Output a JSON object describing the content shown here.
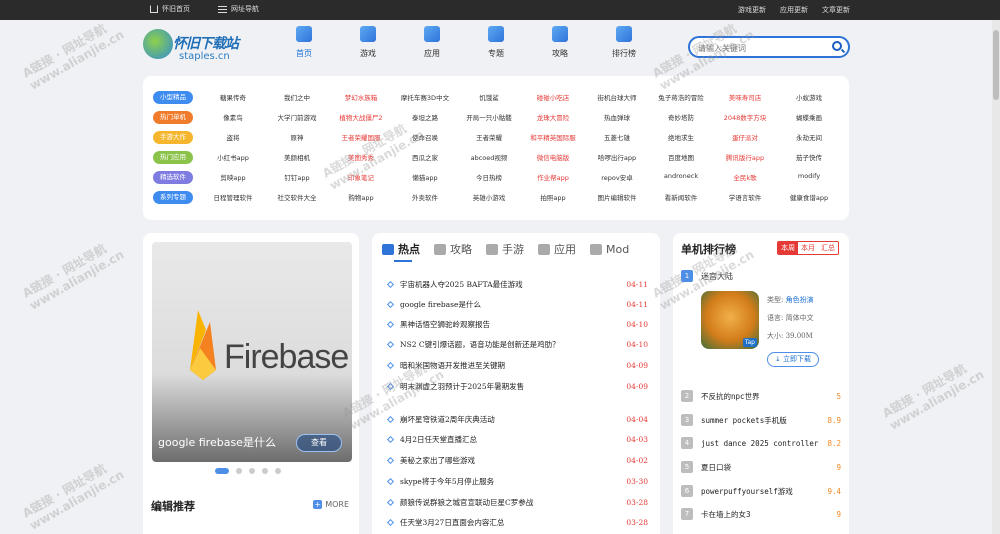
{
  "topbar": {
    "home": "怀旧首页",
    "nav": "网址导航",
    "right_links": [
      "游戏更新",
      "应用更新",
      "文章更新"
    ]
  },
  "logo": {
    "name": "怀旧下载站",
    "url": "staples.cn"
  },
  "nav": [
    "首页",
    "游戏",
    "应用",
    "专题",
    "攻略",
    "排行榜"
  ],
  "search": {
    "placeholder": "请输入关键词"
  },
  "categories": [
    {
      "tag": "小型精品",
      "color": "#3f8cf0",
      "links": [
        {
          "t": "糖果传奇",
          "r": false
        },
        {
          "t": "我们之中",
          "r": false
        },
        {
          "t": "梦幻水族箱",
          "r": true
        },
        {
          "t": "摩托车赛3D中文",
          "r": false
        },
        {
          "t": "饥饿鲨",
          "r": false
        },
        {
          "t": "碰碰小吃店",
          "r": true
        },
        {
          "t": "街机台球大师",
          "r": false
        },
        {
          "t": "兔子蒋浩的冒险",
          "r": false
        },
        {
          "t": "美味寿司店",
          "r": true
        },
        {
          "t": "小蚁游戏",
          "r": false
        }
      ]
    },
    {
      "tag": "热门单机",
      "color": "#f07c2b",
      "links": [
        {
          "t": "像素鸟",
          "r": false
        },
        {
          "t": "大学门前游戏",
          "r": false
        },
        {
          "t": "植物大战僵尸2",
          "r": true
        },
        {
          "t": "泰坦之路",
          "r": false
        },
        {
          "t": "开局一只小骷髅",
          "r": false
        },
        {
          "t": "龙珠大冒险",
          "r": true
        },
        {
          "t": "热血弹球",
          "r": false
        },
        {
          "t": "奇妙塔防",
          "r": false
        },
        {
          "t": "2048数字方块",
          "r": true
        },
        {
          "t": "蝴蝶乘画",
          "r": false
        }
      ]
    },
    {
      "tag": "手游大作",
      "color": "#f5b62e",
      "links": [
        {
          "t": "盗将",
          "r": false
        },
        {
          "t": "原神",
          "r": false
        },
        {
          "t": "王者荣耀国服",
          "r": true
        },
        {
          "t": "使命召唤",
          "r": false
        },
        {
          "t": "王者荣耀",
          "r": false
        },
        {
          "t": "和平精英国际服",
          "r": true
        },
        {
          "t": "五菱七雄",
          "r": false
        },
        {
          "t": "绝地求生",
          "r": false
        },
        {
          "t": "蛋仔派对",
          "r": true
        },
        {
          "t": "永劫无间",
          "r": false
        }
      ]
    },
    {
      "tag": "热门应用",
      "color": "#8bc34a",
      "links": [
        {
          "t": "小红书app",
          "r": false
        },
        {
          "t": "美颜相机",
          "r": false
        },
        {
          "t": "美图秀秀",
          "r": true
        },
        {
          "t": "西瓜之家",
          "r": false
        },
        {
          "t": "abcoed视频",
          "r": false
        },
        {
          "t": "微信电脑版",
          "r": true
        },
        {
          "t": "哈啰出行app",
          "r": false
        },
        {
          "t": "百度地图",
          "r": false
        },
        {
          "t": "腾讯版行app",
          "r": true
        },
        {
          "t": "茄子快传",
          "r": false
        }
      ]
    },
    {
      "tag": "精选软件",
      "color": "#7e7ce0",
      "links": [
        {
          "t": "剪映app",
          "r": false
        },
        {
          "t": "钉钉app",
          "r": false
        },
        {
          "t": "印象笔记",
          "r": true
        },
        {
          "t": "懒猫app",
          "r": false
        },
        {
          "t": "今日热榜",
          "r": false
        },
        {
          "t": "作业帮app",
          "r": true
        },
        {
          "t": "repov安卓",
          "r": false
        },
        {
          "t": "androneck",
          "r": false
        },
        {
          "t": "全民k歌",
          "r": true
        },
        {
          "t": "modify",
          "r": false
        }
      ]
    },
    {
      "tag": "系列专题",
      "color": "#3f8cf0",
      "links": [
        {
          "t": "日程管理软件",
          "r": false
        },
        {
          "t": "社交软件大全",
          "r": false
        },
        {
          "t": "购物app",
          "r": false
        },
        {
          "t": "外卖软件",
          "r": false
        },
        {
          "t": "英雄小游戏",
          "r": false
        },
        {
          "t": "拍照app",
          "r": false
        },
        {
          "t": "图片编辑软件",
          "r": false
        },
        {
          "t": "看新闻软件",
          "r": false
        },
        {
          "t": "学语言软件",
          "r": false
        },
        {
          "t": "健康食谱app",
          "r": false
        }
      ]
    }
  ],
  "banner": {
    "logo_text": "Firebase",
    "caption": "google firebase是什么",
    "button": "查看"
  },
  "editor": {
    "title": "编辑推荐",
    "more": "MORE"
  },
  "tabs": [
    "热点",
    "攻略",
    "手游",
    "应用",
    "Mod"
  ],
  "news": [
    {
      "t": "宇宙机器人夺2025 BAFTA最佳游戏",
      "d": "04-11"
    },
    {
      "t": "google firebase是什么",
      "d": "04-11"
    },
    {
      "t": "黑神话悟空狮驼岭观察报告",
      "d": "04-10"
    },
    {
      "t": "NS2 C键引爆话题，语音功能是创新还是鸡肋？",
      "d": "04-10"
    },
    {
      "t": "暗和米国物语开发推进至关键期",
      "d": "04-09"
    },
    {
      "t": "明末渊虚之羽预计于2025年暑期发售",
      "d": "04-09"
    },
    {
      "t": "崩坏星穹铁道2周年庆典活动",
      "d": "04-04"
    },
    {
      "t": "4月2日任天堂直播汇总",
      "d": "04-03"
    },
    {
      "t": "美秘之家出了哪些游戏",
      "d": "04-02"
    },
    {
      "t": "skype将于今年5月停止服务",
      "d": "03-30"
    },
    {
      "t": "颜狼传说群狼之城官宣联动巨星C罗参战",
      "d": "03-28"
    },
    {
      "t": "任天堂3月27日直面会内容汇总",
      "d": "03-28"
    }
  ],
  "rank": {
    "title": "单机排行榜",
    "tabs": [
      "本周",
      "本月",
      "汇总"
    ],
    "top1": {
      "no": "1",
      "name": "迷宫大陆",
      "category_label": "类型:",
      "category": "角色扮演",
      "lang_label": "语言:",
      "lang": "简体中文",
      "size_label": "大小:",
      "size": "39.00M",
      "download": "立即下载",
      "badge": "Tap"
    },
    "items": [
      {
        "no": "2",
        "name": "不反抗的npc世界",
        "score": "5"
      },
      {
        "no": "3",
        "name": "summer pockets手机版",
        "score": "8.9"
      },
      {
        "no": "4",
        "name": "just dance 2025 controller",
        "score": "8.2"
      },
      {
        "no": "5",
        "name": "夏日口袋",
        "score": "9"
      },
      {
        "no": "6",
        "name": "powerpuffyourself游戏",
        "score": "9.4"
      },
      {
        "no": "7",
        "name": "卡在墙上的女3",
        "score": "9"
      }
    ]
  },
  "watermark": {
    "line1": "A链接 · 网址导航",
    "line2": "www.alianjie.cn"
  }
}
